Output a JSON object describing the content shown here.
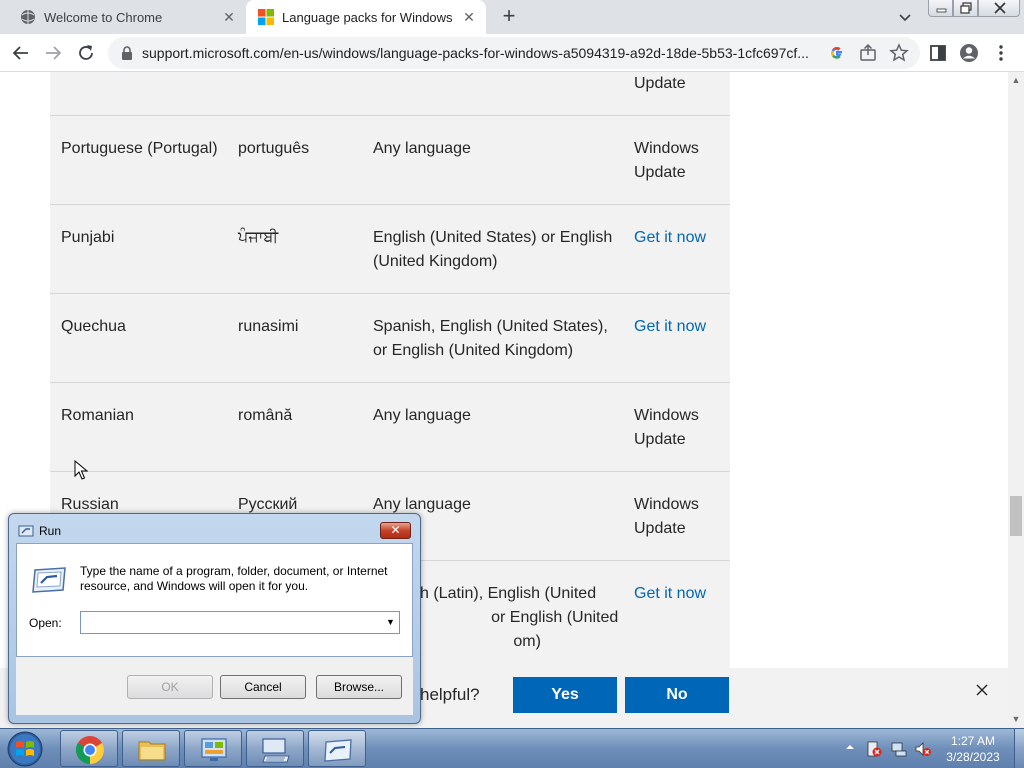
{
  "browser": {
    "tabs": [
      {
        "title": "Welcome to Chrome",
        "active": false
      },
      {
        "title": "Language packs for Windows - Microsoft Support",
        "active": true
      }
    ],
    "url": "support.microsoft.com/en-us/windows/language-packs-for-windows-a5094319-a92d-18de-5b53-1cfc697cf..."
  },
  "table": {
    "top_fragment": "Update",
    "rows": [
      {
        "language": "Portuguese (Portugal)",
        "native": "português",
        "base": "Any language",
        "get": "Windows Update",
        "get_is_link": false
      },
      {
        "language": "Punjabi",
        "native": "ਪੰਜਾਬੀ",
        "base": "English (United States) or English (United Kingdom)",
        "get": "Get it now",
        "get_is_link": true
      },
      {
        "language": "Quechua",
        "native": "runasimi",
        "base": "Spanish, English (United States), or English (United Kingdom)",
        "get": "Get it now",
        "get_is_link": true
      },
      {
        "language": "Romanian",
        "native": "română",
        "base": "Any language",
        "get": "Windows Update",
        "get_is_link": false
      },
      {
        "language": "Russian",
        "native": "Русский",
        "base": "Any language",
        "get": "Windows Update",
        "get_is_link": false
      }
    ],
    "partial_row": {
      "base": "h (Latin), English (United\n                or English (United\n                     om)",
      "get": "Get it now"
    }
  },
  "feedback": {
    "question": "helpful?",
    "yes": "Yes",
    "no": "No"
  },
  "run_dialog": {
    "title": "Run",
    "description": "Type the name of a program, folder, document, or Internet resource, and Windows will open it for you.",
    "open_label": "Open:",
    "input_value": "",
    "ok": "OK",
    "cancel": "Cancel",
    "browse": "Browse..."
  },
  "taskbar": {
    "time": "1:27 AM",
    "date": "3/28/2023"
  },
  "colors": {
    "link": "#0067b8",
    "button_primary": "#0067b8",
    "table_bg": "#f2f2f2"
  }
}
